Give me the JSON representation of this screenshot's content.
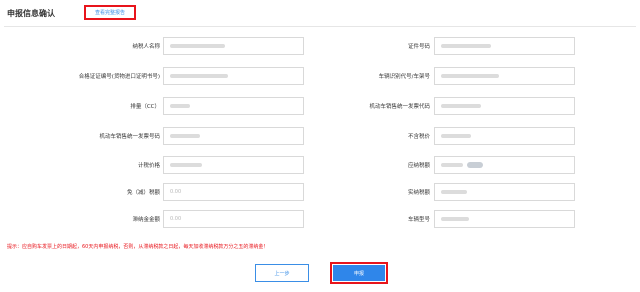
{
  "header": {
    "title": "申报信息确认",
    "view_report_label": "查看完整报告"
  },
  "form": {
    "left": [
      {
        "label": "纳税人名称",
        "value": ""
      },
      {
        "label": "合格证证编号(货物进口证明书号)",
        "value": ""
      },
      {
        "label": "排量（CC）",
        "value": ""
      },
      {
        "label": "机动车销售统一发票号码",
        "value": ""
      },
      {
        "label": "计税价格",
        "value": ""
      },
      {
        "label": "免（减）税额",
        "value": "0.00"
      },
      {
        "label": "滞纳金金额",
        "value": "0.00"
      }
    ],
    "right": [
      {
        "label": "证件号码",
        "value": ""
      },
      {
        "label": "车辆识别代号/车架号",
        "value": ""
      },
      {
        "label": "机动车销售统一发票代码",
        "value": ""
      },
      {
        "label": "不含税价",
        "value": ""
      },
      {
        "label": "应纳税额",
        "value": ""
      },
      {
        "label": "实纳税额",
        "value": ""
      },
      {
        "label": "车辆型号",
        "value": ""
      }
    ]
  },
  "notice": "提示：应自购车发票上的日期起，60天内申报纳税，否则，从滞纳税款之日起，每天加收滞纳税款万分之五的滞纳金！",
  "buttons": {
    "prev_label": "上一步",
    "submit_label": "申报"
  },
  "colors": {
    "accent": "#2f86ea",
    "highlight_border": "#e8141b",
    "notice": "#e8141b",
    "link": "#3a8ee6"
  }
}
